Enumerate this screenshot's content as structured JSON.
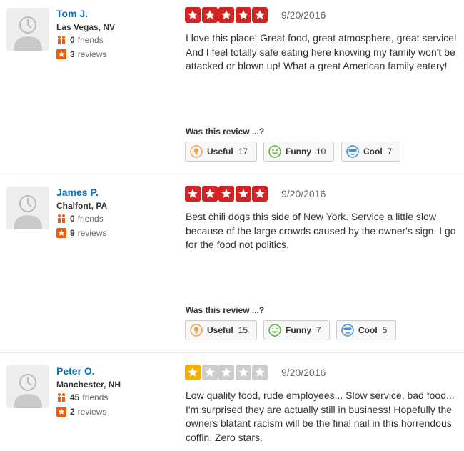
{
  "vote_prompt": "Was this review ...?",
  "colors": {
    "link": "#0073bb",
    "star_5": "#d32323",
    "star_1": "#f0b000",
    "star_empty": "#cccccc",
    "useful": "#f2a04a",
    "funny": "#5fb236",
    "cool": "#3d91d1"
  },
  "reviews": [
    {
      "user": {
        "name": "Tom J.",
        "location": "Las Vegas, NV",
        "friends_count": "0",
        "friends_label": "friends",
        "reviews_count": "3",
        "reviews_label": "reviews"
      },
      "rating": 5,
      "date": "9/20/2016",
      "text": "I love this place! Great food, great atmosphere, great service! And I feel totally safe eating here knowing my family won't be attacked or blown up! What a great American family eatery!",
      "votes": {
        "useful_label": "Useful",
        "useful": "17",
        "funny_label": "Funny",
        "funny": "10",
        "cool_label": "Cool",
        "cool": "7"
      }
    },
    {
      "user": {
        "name": "James P.",
        "location": "Chalfont, PA",
        "friends_count": "0",
        "friends_label": "friends",
        "reviews_count": "9",
        "reviews_label": "reviews"
      },
      "rating": 5,
      "date": "9/20/2016",
      "text": "Best chili dogs this side of New York.  Service a little slow because of the large crowds caused by the owner's sign.  I go for the food not politics.",
      "votes": {
        "useful_label": "Useful",
        "useful": "15",
        "funny_label": "Funny",
        "funny": "7",
        "cool_label": "Cool",
        "cool": "5"
      }
    },
    {
      "user": {
        "name": "Peter O.",
        "location": "Manchester, NH",
        "friends_count": "45",
        "friends_label": "friends",
        "reviews_count": "2",
        "reviews_label": "reviews"
      },
      "rating": 1,
      "date": "9/20/2016",
      "text": "Low quality food, rude employees... Slow service, bad food... I'm surprised they are actually still in business! Hopefully the owners blatant racism will be the final nail in this horrendous coffin.  Zero stars."
    }
  ]
}
